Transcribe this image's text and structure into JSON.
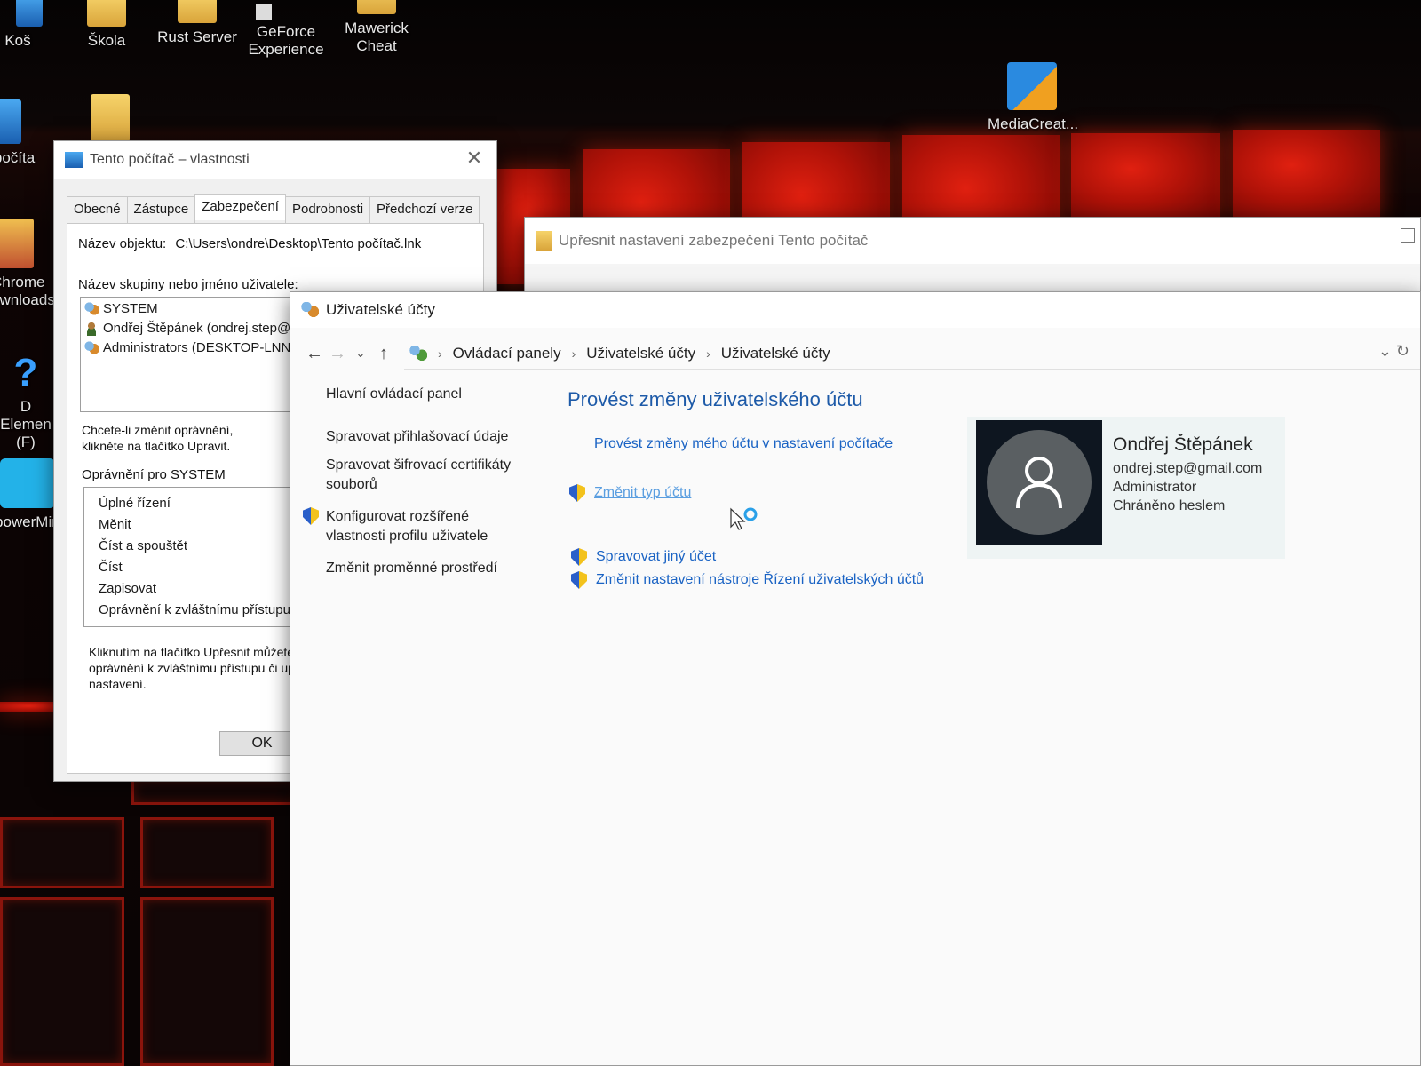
{
  "desktop_icons": [
    {
      "label": "Koš",
      "kind": "bin"
    },
    {
      "label": "Škola",
      "kind": "folder"
    },
    {
      "label": "Rust Server",
      "kind": "folder"
    },
    {
      "label": "GeForce Experience",
      "kind": "app"
    },
    {
      "label": "Mawerick Cheat",
      "kind": "folder"
    },
    {
      "label": "MediaCreat...",
      "kind": "installer"
    },
    {
      "label": "to počíta",
      "kind": "pc"
    },
    {
      "label": "Chrome ownloads",
      "kind": "folder"
    },
    {
      "label": "D Elemen (F)",
      "kind": "drive-help"
    },
    {
      "label": "powerMir",
      "kind": "app"
    }
  ],
  "props_window": {
    "title": "Tento počítač – vlastnosti",
    "tabs": [
      "Obecné",
      "Zástupce",
      "Zabezpečení",
      "Podrobnosti",
      "Předchozí verze"
    ],
    "active_tab": "Zabezpečení",
    "object_name_label": "Název objektu:",
    "object_name_value": "C:\\Users\\ondre\\Desktop\\Tento počítač.lnk",
    "group_label": "Název skupiny nebo jméno uživatele:",
    "principals": [
      {
        "label": "SYSTEM",
        "kind": "group"
      },
      {
        "label": "Ondřej Štěpánek (ondrej.step@g",
        "kind": "user"
      },
      {
        "label": "Administrators (DESKTOP-LNNG",
        "kind": "group"
      }
    ],
    "change_hint_1": "Chcete-li změnit oprávnění,",
    "change_hint_2": "klikněte na tlačítko Upravit.",
    "perm_label": "Oprávnění pro SYSTEM",
    "permissions": [
      "Úplné řízení",
      "Měnit",
      "Číst a spouštět",
      "Číst",
      "Zapisovat",
      "Oprávnění k zvláštnímu přístupu"
    ],
    "adv_hint_1": "Kliknutím na tlačítko Upřesnit můžete",
    "adv_hint_2": "oprávnění k zvláštnímu přístupu či up",
    "adv_hint_3": "nastavení.",
    "ok_label": "OK"
  },
  "advanced_window": {
    "title": "Upřesnit nastavení zabezpečení Tento počítač"
  },
  "ua_window": {
    "title": "Uživatelské účty",
    "breadcrumb": [
      "Ovládací panely",
      "Uživatelské účty",
      "Uživatelské účty"
    ],
    "left_nav": [
      {
        "label": "Hlavní ovládací panel",
        "shield": false
      },
      {
        "label": "Spravovat přihlašovací údaje",
        "shield": false
      },
      {
        "label": "Spravovat šifrovací certifikáty souborů",
        "shield": false
      },
      {
        "label": "Konfigurovat rozšířené vlastnosti profilu uživatele",
        "shield": true
      },
      {
        "label": "Změnit proměnné prostředí",
        "shield": false
      }
    ],
    "heading": "Provést změny uživatelského účtu",
    "links": {
      "pc_settings": "Provést změny mého účtu v nastavení počítače",
      "change_type": "Změnit typ účtu",
      "manage_other": "Spravovat jiný účet",
      "uac_settings": "Změnit nastavení nástroje Řízení uživatelských účtů"
    },
    "user": {
      "name": "Ondřej Štěpánek",
      "email": "ondrej.step@gmail.com",
      "role": "Administrator",
      "status": "Chráněno heslem"
    }
  },
  "colors": {
    "link_blue": "#1a63c4",
    "heading_blue": "#1d5aa8",
    "desktop_red": "#c8160a"
  }
}
